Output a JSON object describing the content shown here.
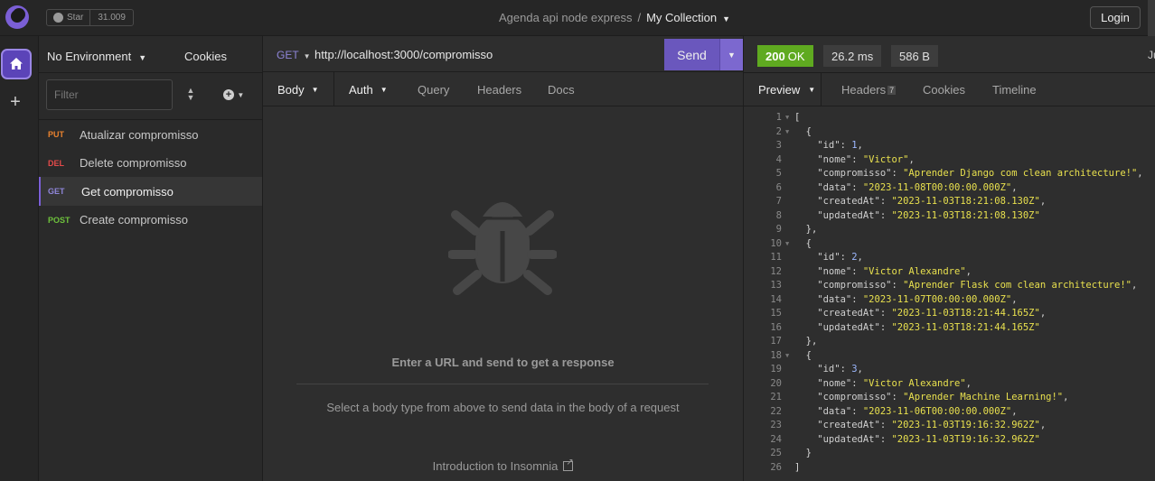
{
  "topbar": {
    "logo_icon": "insomnia-logo-icon",
    "star_label": "Star",
    "star_count": "31.009",
    "project": "Agenda api node express",
    "separator": "/",
    "collection": "My Collection",
    "login_label": "Login"
  },
  "rail": {
    "home_icon": "home-icon",
    "add_icon": "plus-icon"
  },
  "sidebar": {
    "environment": "No Environment",
    "cookies_label": "Cookies",
    "filter_placeholder": "Filter",
    "requests": [
      {
        "method": "PUT",
        "method_color": "#e8822f",
        "name": "Atualizar compromisso",
        "active": false
      },
      {
        "method": "DEL",
        "method_color": "#e34a4a",
        "name": "Delete compromisso",
        "active": false
      },
      {
        "method": "GET",
        "method_color": "#8f86d9",
        "name": "Get compromisso",
        "active": true
      },
      {
        "method": "POST",
        "method_color": "#6ec23c",
        "name": "Create compromisso",
        "active": false
      }
    ]
  },
  "request": {
    "method": "GET",
    "url": "http://localhost:3000/compromisso",
    "send_label": "Send",
    "tabs": [
      "Body",
      "Auth",
      "Query",
      "Headers",
      "Docs"
    ],
    "empty_title": "Enter a URL and send to get a response",
    "empty_sub": "Select a body type from above to send data in the body of a request",
    "intro_link": "Introduction to Insomnia"
  },
  "response": {
    "status_code": "200",
    "status_text": "OK",
    "time": "26.2 ms",
    "size": "586 B",
    "cut_label": "Ju",
    "tabs": [
      "Preview",
      "Headers",
      "Cookies",
      "Timeline"
    ],
    "headers_count": "7",
    "lines": [
      {
        "n": "1",
        "fold": true,
        "t": "["
      },
      {
        "n": "2",
        "fold": true,
        "t": "  {"
      },
      {
        "n": "3",
        "k": "\"id\"",
        "v": "1",
        "num": true,
        "c": ","
      },
      {
        "n": "4",
        "k": "\"nome\"",
        "v": "\"Victor\"",
        "c": ","
      },
      {
        "n": "5",
        "k": "\"compromisso\"",
        "v": "\"Aprender Django com clean architecture!\"",
        "c": ","
      },
      {
        "n": "6",
        "k": "\"data\"",
        "v": "\"2023-11-08T00:00:00.000Z\"",
        "c": ","
      },
      {
        "n": "7",
        "k": "\"createdAt\"",
        "v": "\"2023-11-03T18:21:08.130Z\"",
        "c": ","
      },
      {
        "n": "8",
        "k": "\"updatedAt\"",
        "v": "\"2023-11-03T18:21:08.130Z\"",
        "c": ""
      },
      {
        "n": "9",
        "t": "  },"
      },
      {
        "n": "10",
        "fold": true,
        "t": "  {"
      },
      {
        "n": "11",
        "k": "\"id\"",
        "v": "2",
        "num": true,
        "c": ","
      },
      {
        "n": "12",
        "k": "\"nome\"",
        "v": "\"Victor Alexandre\"",
        "c": ","
      },
      {
        "n": "13",
        "k": "\"compromisso\"",
        "v": "\"Aprender Flask com clean architecture!\"",
        "c": ","
      },
      {
        "n": "14",
        "k": "\"data\"",
        "v": "\"2023-11-07T00:00:00.000Z\"",
        "c": ","
      },
      {
        "n": "15",
        "k": "\"createdAt\"",
        "v": "\"2023-11-03T18:21:44.165Z\"",
        "c": ","
      },
      {
        "n": "16",
        "k": "\"updatedAt\"",
        "v": "\"2023-11-03T18:21:44.165Z\"",
        "c": ""
      },
      {
        "n": "17",
        "t": "  },"
      },
      {
        "n": "18",
        "fold": true,
        "t": "  {"
      },
      {
        "n": "19",
        "k": "\"id\"",
        "v": "3",
        "num": true,
        "c": ","
      },
      {
        "n": "20",
        "k": "\"nome\"",
        "v": "\"Victor Alexandre\"",
        "c": ","
      },
      {
        "n": "21",
        "k": "\"compromisso\"",
        "v": "\"Aprender Machine Learning!\"",
        "c": ","
      },
      {
        "n": "22",
        "k": "\"data\"",
        "v": "\"2023-11-06T00:00:00.000Z\"",
        "c": ","
      },
      {
        "n": "23",
        "k": "\"createdAt\"",
        "v": "\"2023-11-03T19:16:32.962Z\"",
        "c": ","
      },
      {
        "n": "24",
        "k": "\"updatedAt\"",
        "v": "\"2023-11-03T19:16:32.962Z\"",
        "c": ""
      },
      {
        "n": "25",
        "t": "  }"
      },
      {
        "n": "26",
        "t": "]"
      }
    ]
  }
}
